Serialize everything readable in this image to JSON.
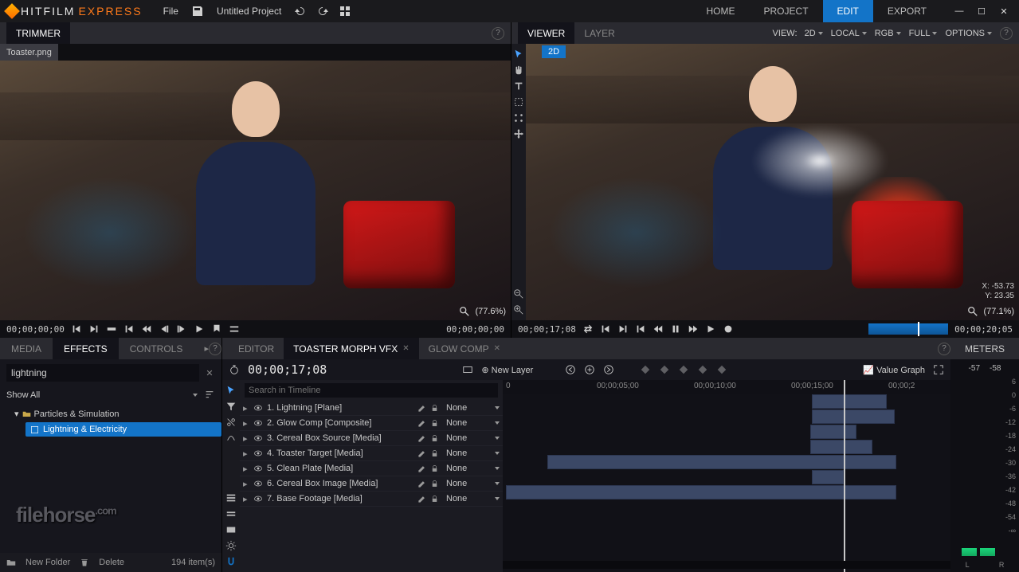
{
  "app": {
    "brand1": "HITFILM",
    "brand2": "EXPRESS",
    "project_title": "Untitled Project"
  },
  "menu": {
    "file": "File"
  },
  "nav": {
    "home": "HOME",
    "project": "PROJECT",
    "edit": "EDIT",
    "export": "EXPORT"
  },
  "trimmer": {
    "title": "TRIMMER",
    "file_tab": "Toaster.png",
    "zoom": "(77.6%)",
    "tc_left": "00;00;00;00",
    "tc_right": "00;00;00;00"
  },
  "viewer": {
    "title": "VIEWER",
    "layer_tab": "LAYER",
    "view_label": "VIEW:",
    "view_mode": "2D",
    "space": "LOCAL",
    "channel": "RGB",
    "quality": "FULL",
    "options": "OPTIONS",
    "chip_2d": "2D",
    "x_label": "X:",
    "x_val": "-53.73",
    "y_label": "Y:",
    "y_val": "23.35",
    "zoom": "(77.1%)",
    "tc_left": "00;00;17;08",
    "tc_right": "00;00;20;05"
  },
  "effects": {
    "tab_media": "MEDIA",
    "tab_effects": "EFFECTS",
    "tab_controls": "CONTROLS",
    "search_value": "lightning",
    "show_all": "Show All",
    "folder": "Particles & Simulation",
    "item": "Lightning & Electricity",
    "new_folder": "New Folder",
    "delete": "Delete",
    "count": "194 item(s)"
  },
  "timeline": {
    "tab_editor": "EDITOR",
    "tab_active": "TOASTER MORPH VFX",
    "tab_glow": "GLOW COMP",
    "timecode": "00;00;17;08",
    "new_layer": "New Layer",
    "search_ph": "Search in Timeline",
    "value_graph": "Value Graph",
    "ruler": [
      "0",
      "00;00;05;00",
      "00;00;10;00",
      "00;00;15;00",
      "00;00;2"
    ],
    "layers": [
      {
        "n": "1.",
        "name": "Lightning [Plane]",
        "blend": "None"
      },
      {
        "n": "2.",
        "name": "Glow Comp [Composite]",
        "blend": "None"
      },
      {
        "n": "3.",
        "name": "Cereal Box Source [Media]",
        "blend": "None"
      },
      {
        "n": "4.",
        "name": "Toaster Target [Media]",
        "blend": "None"
      },
      {
        "n": "5.",
        "name": "Clean Plate [Media]",
        "blend": "None"
      },
      {
        "n": "6.",
        "name": "Cereal Box Image [Media]",
        "blend": "None"
      },
      {
        "n": "7.",
        "name": "Base Footage [Media]",
        "blend": "None"
      }
    ]
  },
  "meters": {
    "title": "METERS",
    "peak_l": "-57",
    "peak_r": "-58",
    "ticks": [
      "6",
      "0",
      "-6",
      "-12",
      "-18",
      "-24",
      "-30",
      "-36",
      "-42",
      "-48",
      "-54",
      "-∞"
    ],
    "L": "L",
    "R": "R"
  },
  "watermark": "filehorse",
  "watermark_suffix": ".com"
}
